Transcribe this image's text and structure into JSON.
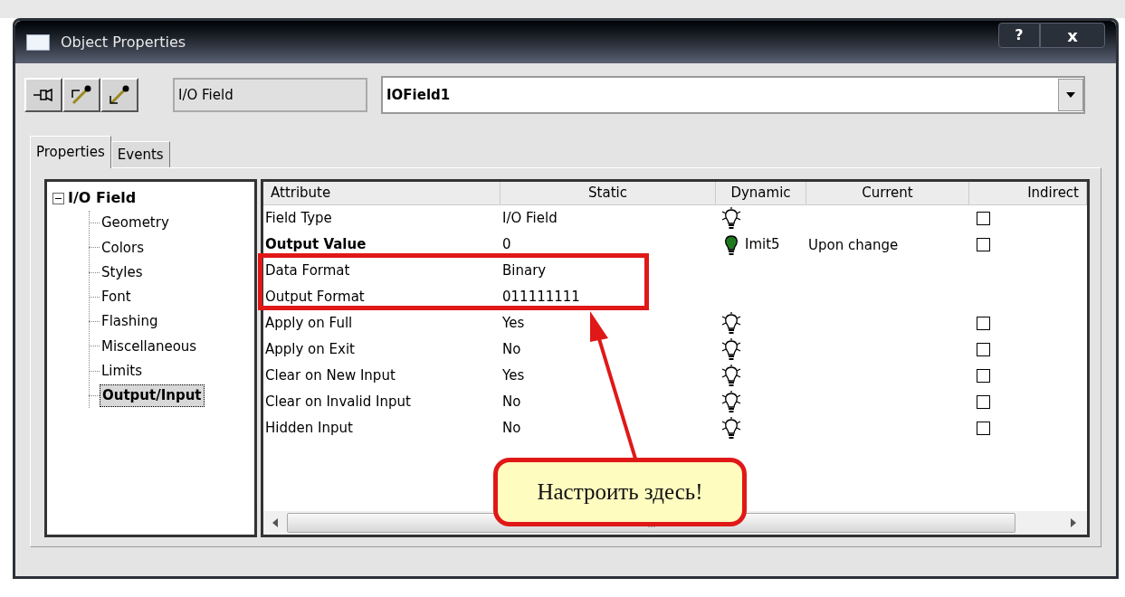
{
  "window": {
    "title": "Object Properties",
    "help": "?",
    "close": "x"
  },
  "toolbar": {
    "object_type": "I/O Field",
    "object_name": "IOField1"
  },
  "tabs": [
    {
      "label": "Properties",
      "selected": true
    },
    {
      "label": "Events",
      "selected": false
    }
  ],
  "tree": {
    "label": "I/O Field",
    "expanded": true,
    "children": [
      {
        "label": "Geometry",
        "selected": false
      },
      {
        "label": "Colors",
        "selected": false
      },
      {
        "label": "Styles",
        "selected": false
      },
      {
        "label": "Font",
        "selected": false
      },
      {
        "label": "Flashing",
        "selected": false
      },
      {
        "label": "Miscellaneous",
        "selected": false
      },
      {
        "label": "Limits",
        "selected": false
      },
      {
        "label": "Output/Input",
        "selected": true
      }
    ]
  },
  "table": {
    "columns": [
      "Attribute",
      "Static",
      "Dynamic",
      "Current",
      "Indirect"
    ],
    "rows": [
      {
        "attribute": "Field Type",
        "bold": false,
        "static": "I/O Field",
        "dynamic": {
          "kind": "lamp",
          "on": false
        },
        "indirect": {
          "checked": false
        }
      },
      {
        "attribute": "Output Value",
        "bold": true,
        "static": "0",
        "dynamic": {
          "kind": "lamp",
          "on": true,
          "tag": "Imit5"
        },
        "current": "Upon change",
        "indirect": {
          "checked": false
        }
      },
      {
        "attribute": "Data Format",
        "bold": false,
        "static": "Binary"
      },
      {
        "attribute": "Output Format",
        "bold": false,
        "static": "011111111"
      },
      {
        "attribute": "Apply on Full",
        "bold": false,
        "static": "Yes",
        "dynamic": {
          "kind": "lamp",
          "on": false
        },
        "indirect": {
          "checked": false
        }
      },
      {
        "attribute": "Apply on Exit",
        "bold": false,
        "static": "No",
        "dynamic": {
          "kind": "lamp",
          "on": false
        },
        "indirect": {
          "checked": false
        }
      },
      {
        "attribute": "Clear on New Input",
        "bold": false,
        "static": "Yes",
        "dynamic": {
          "kind": "lamp",
          "on": false
        },
        "indirect": {
          "checked": false
        }
      },
      {
        "attribute": "Clear on Invalid Input",
        "bold": false,
        "static": "No",
        "dynamic": {
          "kind": "lamp",
          "on": false
        },
        "indirect": {
          "checked": false
        }
      },
      {
        "attribute": "Hidden Input",
        "bold": false,
        "static": "No",
        "dynamic": {
          "kind": "lamp",
          "on": false
        },
        "indirect": {
          "checked": false
        }
      }
    ]
  },
  "annotation": {
    "text": "Настроить здесь!"
  }
}
